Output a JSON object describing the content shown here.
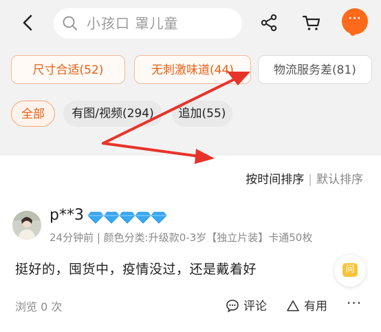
{
  "search": {
    "placeholder": "小孩口 罩儿童"
  },
  "header": {
    "more_glyph": "···"
  },
  "filter_tags": [
    {
      "label": "尺寸合适(52)"
    },
    {
      "label": "无刺激味道(44)"
    },
    {
      "label": "物流服务差(81)"
    }
  ],
  "filter_pills": [
    {
      "label": "全部"
    },
    {
      "label": "有图/视频(294)"
    },
    {
      "label": "追加(55)"
    }
  ],
  "sort": {
    "by_time": "按时间排序",
    "separator": "|",
    "default": "默认排序"
  },
  "review": {
    "username": "p**3",
    "meta": "24分钟前 | 颜色分类:升级款0-3岁【独立片装】卡通50枚",
    "text": "挺好的，囤货中，疫情没过，还是戴着好",
    "views": "浏览 0 次",
    "comment_label": "评论",
    "useful_label": "有用",
    "ask_glyph": "问",
    "more_glyph": "···"
  },
  "colors": {
    "accent": "#ff6a1a",
    "tag_text_orange": "#e95f14",
    "gem": "#39a8f0",
    "annotation_arrow": "#e8332a"
  }
}
